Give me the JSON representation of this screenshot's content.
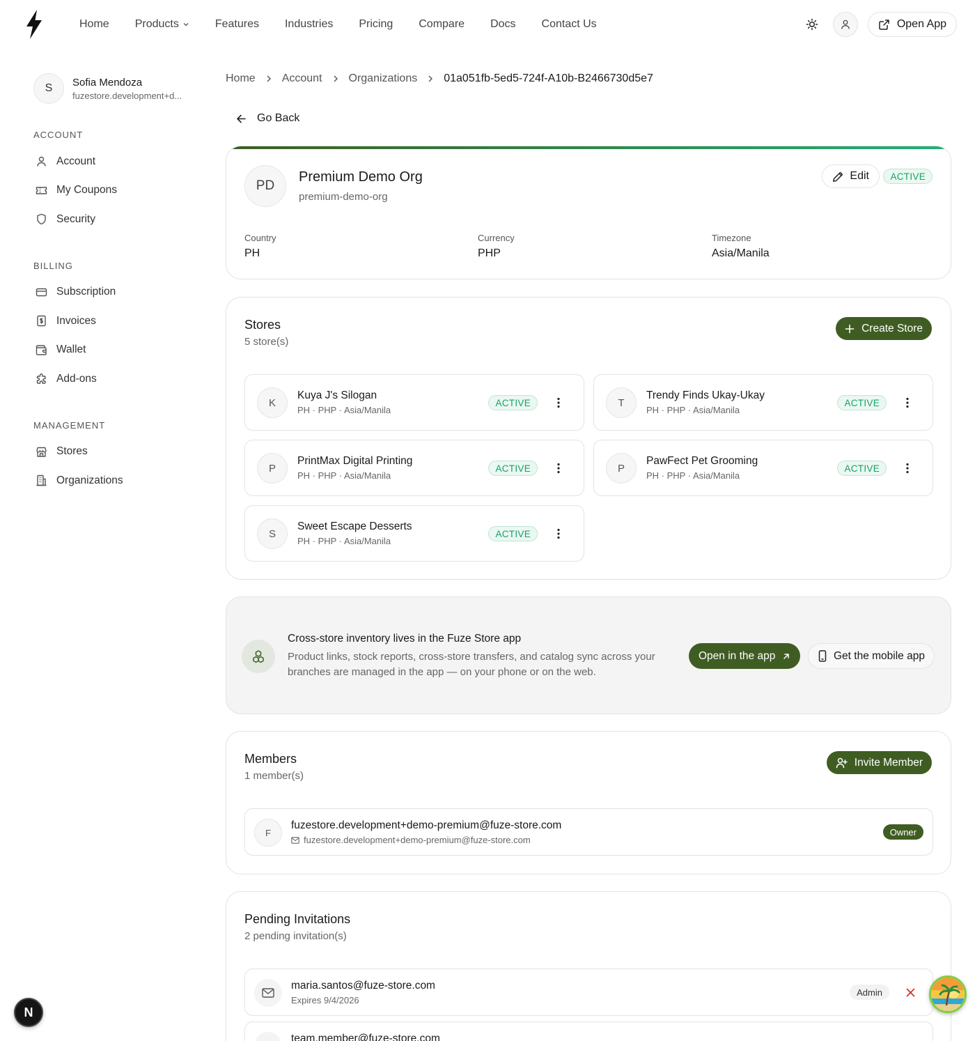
{
  "nav": {
    "links": [
      "Home",
      "Products",
      "Features",
      "Industries",
      "Pricing",
      "Compare",
      "Docs",
      "Contact Us"
    ],
    "open_app_label": "Open App"
  },
  "sidebar": {
    "user": {
      "initial": "S",
      "name": "Sofia Mendoza",
      "email": "fuzestore.development+d..."
    },
    "sections": [
      {
        "title": "ACCOUNT",
        "items": [
          {
            "label": "Account",
            "icon": "user-icon"
          },
          {
            "label": "My Coupons",
            "icon": "ticket-icon"
          },
          {
            "label": "Security",
            "icon": "shield-icon"
          }
        ]
      },
      {
        "title": "BILLING",
        "items": [
          {
            "label": "Subscription",
            "icon": "credit-card-icon"
          },
          {
            "label": "Invoices",
            "icon": "receipt-icon"
          },
          {
            "label": "Wallet",
            "icon": "wallet-icon"
          },
          {
            "label": "Add-ons",
            "icon": "puzzle-icon"
          }
        ]
      },
      {
        "title": "MANAGEMENT",
        "items": [
          {
            "label": "Stores",
            "icon": "store-icon"
          },
          {
            "label": "Organizations",
            "icon": "building-icon"
          }
        ]
      }
    ]
  },
  "breadcrumb": [
    "Home",
    "Account",
    "Organizations",
    "01a051fb-5ed5-724f-A10b-B2466730d5e7"
  ],
  "go_back_label": "Go Back",
  "org": {
    "initials": "PD",
    "name": "Premium Demo Org",
    "slug": "premium-demo-org",
    "edit_label": "Edit",
    "status": "ACTIVE",
    "country_label": "Country",
    "country": "PH",
    "currency_label": "Currency",
    "currency": "PHP",
    "timezone_label": "Timezone",
    "timezone": "Asia/Manila"
  },
  "stores": {
    "title": "Stores",
    "count_text": "5 store(s)",
    "create_label": "Create Store",
    "items": [
      {
        "initial": "K",
        "name": "Kuya J's Silogan",
        "meta": "PH · PHP · Asia/Manila",
        "status": "ACTIVE"
      },
      {
        "initial": "T",
        "name": "Trendy Finds Ukay-Ukay",
        "meta": "PH · PHP · Asia/Manila",
        "status": "ACTIVE"
      },
      {
        "initial": "P",
        "name": "PrintMax Digital Printing",
        "meta": "PH · PHP · Asia/Manila",
        "status": "ACTIVE"
      },
      {
        "initial": "P",
        "name": "PawFect Pet Grooming",
        "meta": "PH · PHP · Asia/Manila",
        "status": "ACTIVE"
      },
      {
        "initial": "S",
        "name": "Sweet Escape Desserts",
        "meta": "PH · PHP · Asia/Manila",
        "status": "ACTIVE"
      }
    ]
  },
  "promo": {
    "title": "Cross-store inventory lives in the Fuze Store app",
    "body": "Product links, stock reports, cross-store transfers, and catalog sync across your branches are managed in the app — on your phone or on the web.",
    "open_label": "Open in the app",
    "mobile_label": "Get the mobile app"
  },
  "members": {
    "title": "Members",
    "count_text": "1 member(s)",
    "invite_label": "Invite Member",
    "items": [
      {
        "initial": "F",
        "name": "fuzestore.development+demo-premium@fuze-store.com",
        "email": "fuzestore.development+demo-premium@fuze-store.com",
        "role": "Owner"
      }
    ]
  },
  "pending": {
    "title": "Pending Invitations",
    "count_text": "2 pending invitation(s)",
    "items": [
      {
        "email": "maria.santos@fuze-store.com",
        "expires": "Expires 9/4/2026",
        "role": "Admin"
      },
      {
        "email": "team.member@fuze-store.com",
        "expires": "",
        "role": ""
      }
    ]
  },
  "floating": {
    "n_badge": "N"
  },
  "colors": {
    "brand_green": "#3f5d22",
    "active_green": "#17a06a",
    "danger_red": "#d92b2b"
  }
}
